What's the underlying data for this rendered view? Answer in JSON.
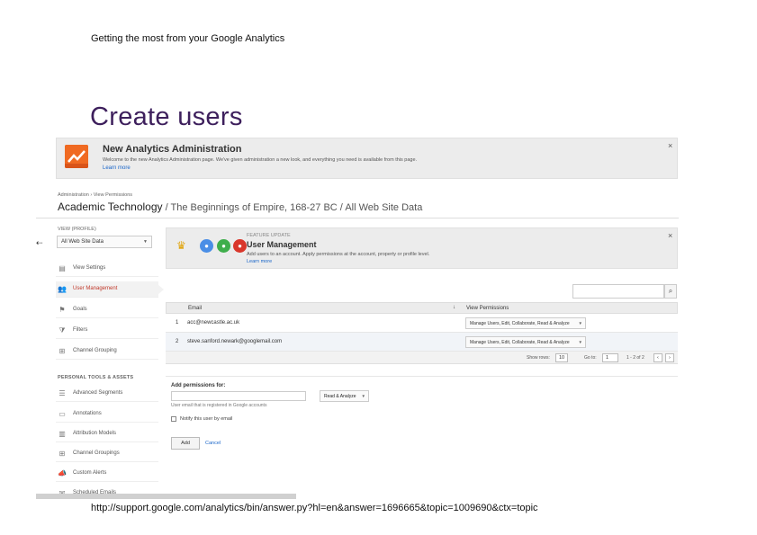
{
  "slide": {
    "header": "Getting the most from your Google Analytics",
    "title": "Create users",
    "footer_url": "http://support.google.com/analytics/bin/answer.py?hl=en&answer=1696665&topic=1009690&ctx=topic"
  },
  "banner": {
    "title": "New Analytics Administration",
    "text": "Welcome to the new Analytics Administration page. We've given administration a new look, and everything you need is available from this page.",
    "link": "Learn more",
    "close": "×",
    "logo_icon": "analytics-logo-icon",
    "logo_color": "#f06a22"
  },
  "breadcrumb": "Administration › View Permissions",
  "property": {
    "account": "Academic Technology",
    "rest": " / The Beginnings of Empire, 168-27 BC / All Web Site Data"
  },
  "sidebar": {
    "back": "⇠",
    "view_label": "VIEW (PROFILE)",
    "view_value": "All Web Site Data",
    "items": [
      {
        "label": "View Settings",
        "icon": "▤"
      },
      {
        "label": "User Management",
        "icon": "👥"
      },
      {
        "label": "Goals",
        "icon": "⚑"
      },
      {
        "label": "Filters",
        "icon": "⧩"
      },
      {
        "label": "Channel Grouping",
        "icon": "⊞"
      }
    ],
    "section_label": "PERSONAL TOOLS & ASSETS",
    "tools": [
      {
        "label": "Advanced Segments",
        "icon": "☰"
      },
      {
        "label": "Annotations",
        "icon": "▭"
      },
      {
        "label": "Attribution Models",
        "icon": "▥"
      },
      {
        "label": "Channel Groupings",
        "icon": "⊞"
      },
      {
        "label": "Custom Alerts",
        "icon": "📣"
      },
      {
        "label": "Scheduled Emails",
        "icon": "✉"
      }
    ]
  },
  "feature": {
    "kicker": "FEATURE UPDATE",
    "title": "User Management",
    "text": "Add users to an account. Apply permissions at the account, property or profile level.",
    "link": "Learn more",
    "close": "×"
  },
  "users_table": {
    "col_email": "Email",
    "sort_arrow": "↓",
    "col_permissions": "View Permissions",
    "rows": [
      {
        "num": "1",
        "email": "acc@newcastle.ac.uk",
        "permission": "Manage Users, Edit, Collaborate, Read & Analyze"
      },
      {
        "num": "2",
        "email": "steve.sanford.newark@googlemail.com",
        "permission": "Manage Users, Edit, Collaborate, Read & Analyze"
      }
    ],
    "pager": {
      "show_rows_label": "Show rows:",
      "show_rows_value": "10",
      "goto_label": "Go to:",
      "goto_value": "1",
      "range": "1 - 2 of 2",
      "prev": "‹",
      "next": "›"
    }
  },
  "add_permissions": {
    "title": "Add permissions for:",
    "hint": "User email that is registered in Google accounts",
    "permission_value": "Read & Analyze",
    "notify_label": "Notify this user by email",
    "add_label": "Add",
    "cancel_label": "Cancel"
  }
}
